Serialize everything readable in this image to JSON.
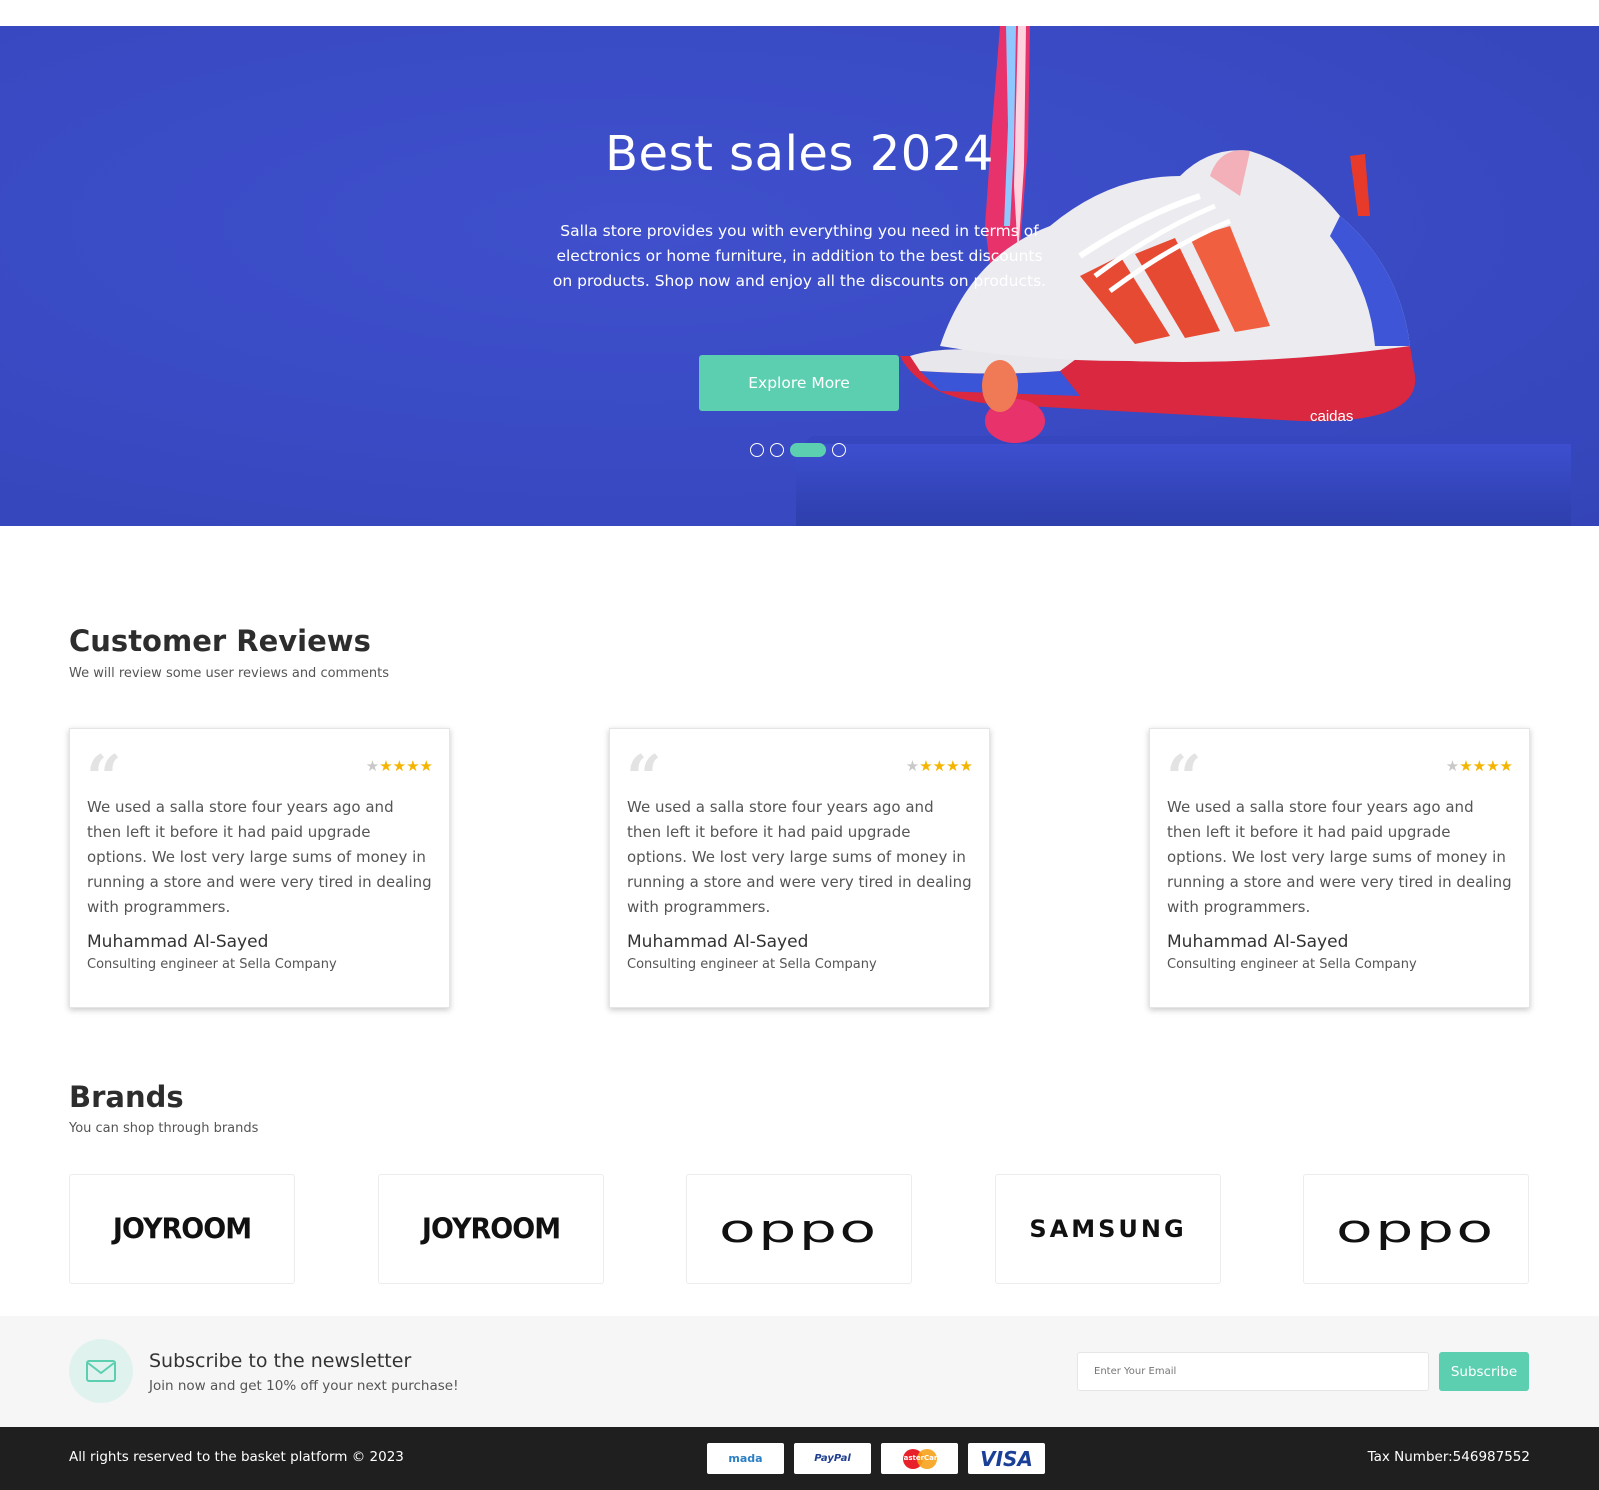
{
  "hero": {
    "title": "Best sales 2024",
    "text": "Salla store provides you with everything you need in terms of electronics or home furniture, in addition to the best discounts on products. Shop now and enjoy all the discounts on products.",
    "button_label": "Explore More",
    "shoe_brand_text": "caidas",
    "active_slide": 3,
    "slide_count": 4
  },
  "reviews_section": {
    "title": "Customer Reviews",
    "subtitle": "We will review some user reviews and comments",
    "reviews": [
      {
        "text": "We used a salla store four years ago and then left it before it had paid upgrade options. We lost very large sums of money in running a store and were very tired in dealing with programmers.",
        "name": "Muhammad Al-Sayed",
        "role": "Consulting engineer at Sella Company",
        "rating": 4
      },
      {
        "text": "We used a salla store four years ago and then left it before it had paid upgrade options. We lost very large sums of money in running a store and were very tired in dealing with programmers.",
        "name": "Muhammad Al-Sayed",
        "role": "Consulting engineer at Sella Company",
        "rating": 4
      },
      {
        "text": "We used a salla store four years ago and then left it before it had paid upgrade options. We lost very large sums of money in running a store and were very tired in dealing with programmers.",
        "name": "Muhammad Al-Sayed",
        "role": "Consulting engineer at Sella Company",
        "rating": 4
      }
    ]
  },
  "brands_section": {
    "title": "Brands",
    "subtitle": "You can shop through brands",
    "brands": [
      "JOYROOM",
      "JOYROOM",
      "oppo",
      "SAMSUNG",
      "oppo"
    ]
  },
  "newsletter": {
    "title": "Subscribe to the newsletter",
    "subtitle": "Join now and get 10% off your next purchase!",
    "input_placeholder": "Enter Your Email",
    "button_label": "Subscribe"
  },
  "footer": {
    "copyright": "All rights reserved to the basket platform © 2023",
    "tax": "Tax Number:546987552",
    "payment_methods": [
      "mada",
      "PayPal",
      "MasterCard",
      "VISA"
    ]
  },
  "colors": {
    "hero_bg": "#3a4bc6",
    "accent": "#5dcfb1",
    "footer_bg": "#1f1f1f",
    "star": "#f4b400"
  }
}
